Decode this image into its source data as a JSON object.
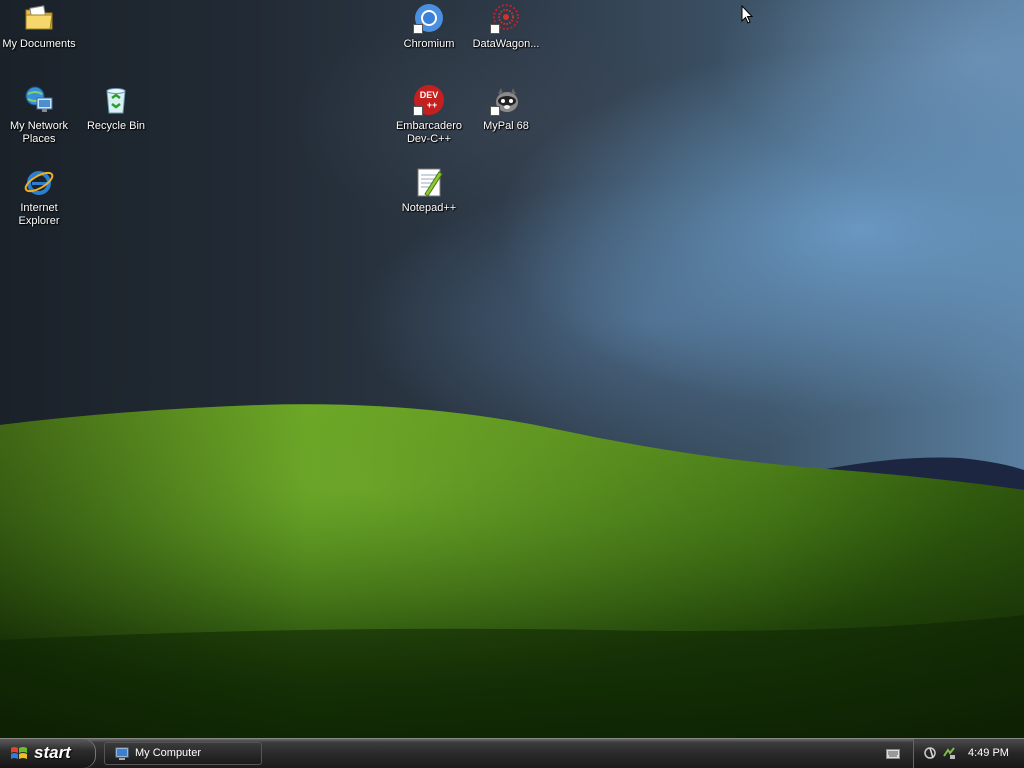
{
  "desktop": {
    "icons": [
      {
        "label": "My Documents",
        "icon": "folder-documents-icon"
      },
      {
        "label": "My Network\nPlaces",
        "icon": "network-places-icon"
      },
      {
        "label": "Recycle Bin",
        "icon": "recycle-bin-icon"
      },
      {
        "label": "Internet\nExplorer",
        "icon": "internet-explorer-icon"
      },
      {
        "label": "Chromium",
        "icon": "chromium-icon"
      },
      {
        "label": "DataWagon...",
        "icon": "datawagon-icon"
      },
      {
        "label": "Embarcadero\nDev-C++",
        "icon": "devcpp-icon"
      },
      {
        "label": "MyPal 68",
        "icon": "mypal-icon"
      },
      {
        "label": "Notepad++",
        "icon": "notepadpp-icon"
      }
    ],
    "devcpp_badge": {
      "line1": "DEV",
      "line2": "++"
    }
  },
  "taskbar": {
    "start_label": "start",
    "tasks": [
      {
        "label": "My Computer",
        "icon": "my-computer-icon"
      }
    ],
    "tray": {
      "clock": "4:49 PM"
    }
  },
  "colors": {
    "taskbar_bg": "#2a2a2a",
    "label_text": "#ffffff",
    "hill_green": "#3f7a12"
  }
}
